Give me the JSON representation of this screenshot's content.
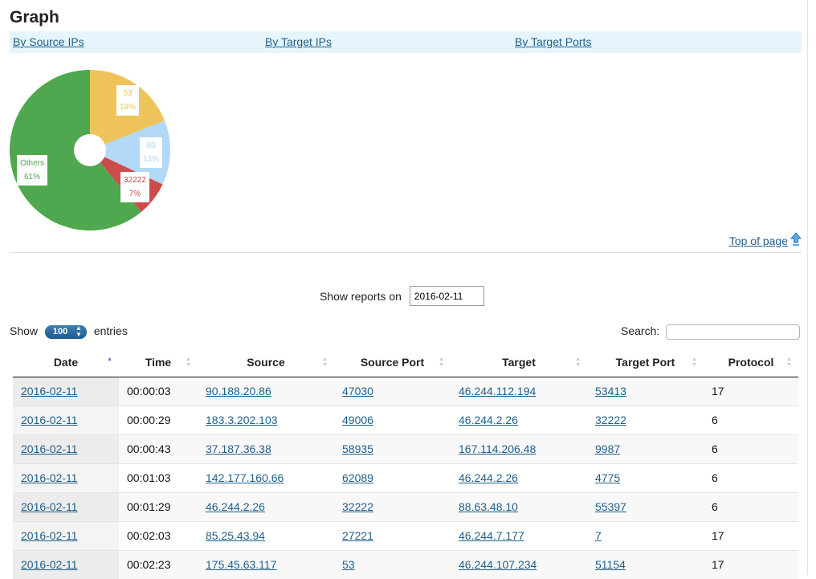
{
  "page": {
    "title": "Graph"
  },
  "tabs": [
    {
      "label": "By Source IPs"
    },
    {
      "label": "By Target IPs"
    },
    {
      "label": "By Target Ports"
    }
  ],
  "chart_data": {
    "type": "pie",
    "title": "",
    "slices": [
      {
        "label": "53",
        "percent_label": "19%",
        "value": 19,
        "color": "#eec45a"
      },
      {
        "label": "80",
        "percent_label": "13%",
        "value": 13,
        "color": "#b2d9f7"
      },
      {
        "label": "32222",
        "percent_label": "7%",
        "value": 7,
        "color": "#cc4b4b"
      },
      {
        "label": "Others",
        "percent_label": "61%",
        "value": 61,
        "color": "#4fa84f"
      }
    ]
  },
  "top_link": {
    "label": "Top of page",
    "icon": "arrow-up-icon"
  },
  "reports": {
    "label": "Show reports on",
    "date_value": "2016-02-11"
  },
  "length": {
    "show_label": "Show",
    "selected": "100",
    "entries_label": "entries"
  },
  "search": {
    "label": "Search:",
    "value": ""
  },
  "table": {
    "columns": [
      "Date",
      "Time",
      "Source",
      "Source Port",
      "Target",
      "Target Port",
      "Protocol"
    ],
    "rows": [
      [
        "2016-02-11",
        "00:00:03",
        "90.188.20.86",
        "47030",
        "46.244.112.194",
        "53413",
        "17"
      ],
      [
        "2016-02-11",
        "00:00:29",
        "183.3.202.103",
        "49006",
        "46.244.2.26",
        "32222",
        "6"
      ],
      [
        "2016-02-11",
        "00:00:43",
        "37.187.36.38",
        "58935",
        "167.114.206.48",
        "9987",
        "6"
      ],
      [
        "2016-02-11",
        "00:01:03",
        "142.177.160.66",
        "62089",
        "46.244.2.26",
        "4775",
        "6"
      ],
      [
        "2016-02-11",
        "00:01:29",
        "46.244.2.26",
        "32222",
        "88.63.48.10",
        "55397",
        "6"
      ],
      [
        "2016-02-11",
        "00:02:03",
        "85.25.43.94",
        "27221",
        "46.244.7.177",
        "7",
        "17"
      ],
      [
        "2016-02-11",
        "00:02:23",
        "175.45.63.117",
        "53",
        "46.244.107.234",
        "51154",
        "17"
      ]
    ]
  }
}
